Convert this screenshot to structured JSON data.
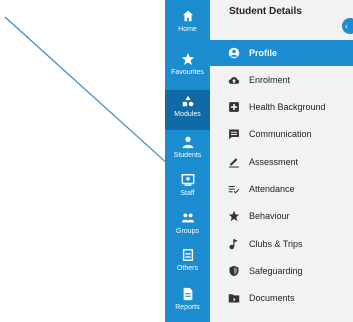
{
  "rail": {
    "items": [
      {
        "label": "Home",
        "icon": "home-icon"
      },
      {
        "label": "Favourites",
        "icon": "star-icon"
      },
      {
        "label": "Modules",
        "icon": "modules-icon"
      },
      {
        "label": "Students",
        "icon": "student-icon"
      },
      {
        "label": "Staff",
        "icon": "staff-icon"
      },
      {
        "label": "Groups",
        "icon": "groups-icon"
      },
      {
        "label": "Others",
        "icon": "others-icon"
      },
      {
        "label": "Reports",
        "icon": "reports-icon"
      }
    ],
    "active": "Modules"
  },
  "panel": {
    "title": "Student Details",
    "items": [
      {
        "label": "Profile",
        "icon": "profile-icon"
      },
      {
        "label": "Enrolment",
        "icon": "cloud-icon"
      },
      {
        "label": "Health Background",
        "icon": "health-icon"
      },
      {
        "label": "Communication",
        "icon": "message-icon"
      },
      {
        "label": "Assessment",
        "icon": "pencil-icon"
      },
      {
        "label": "Attendance",
        "icon": "attendance-icon"
      },
      {
        "label": "Behaviour",
        "icon": "behaviour-icon"
      },
      {
        "label": "Clubs & Trips",
        "icon": "clubs-icon"
      },
      {
        "label": "Safeguarding",
        "icon": "shield-icon"
      },
      {
        "label": "Documents",
        "icon": "folder-icon"
      }
    ],
    "active": "Profile"
  },
  "colors": {
    "accent": "#1a8ccf",
    "rail_active": "#0f6aa6",
    "panel_bg": "#f2f2f2",
    "annotation_line": "#3d86c6"
  }
}
